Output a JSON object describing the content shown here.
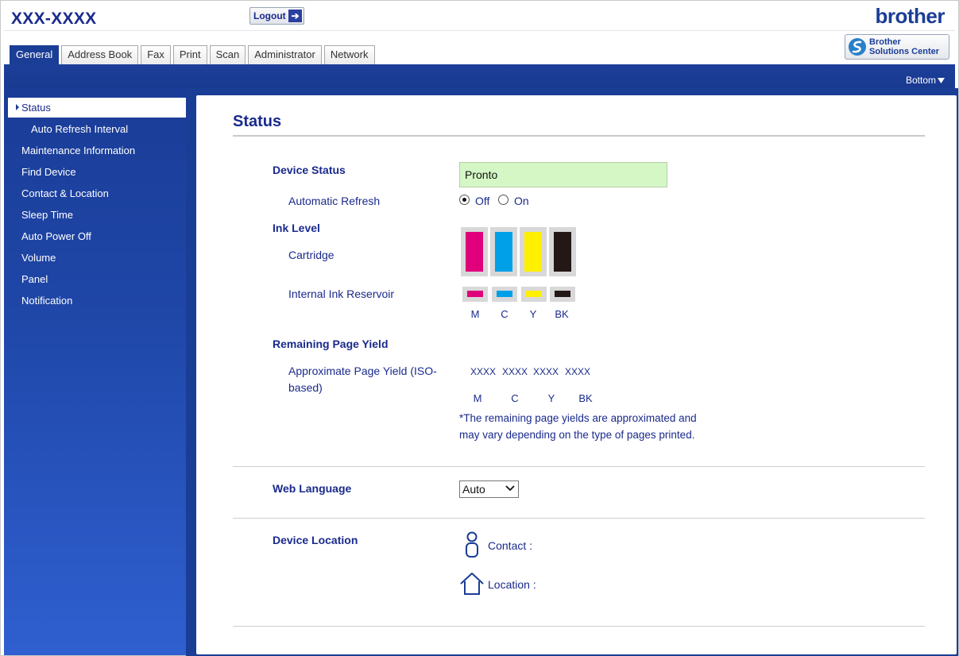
{
  "header": {
    "model": "XXX-XXXX",
    "logout_label": "Logout",
    "logo": "brother",
    "solutions_line1": "Brother",
    "solutions_line2": "Solutions Center"
  },
  "tabs": [
    {
      "label": "General",
      "active": true
    },
    {
      "label": "Address Book"
    },
    {
      "label": "Fax"
    },
    {
      "label": "Print"
    },
    {
      "label": "Scan"
    },
    {
      "label": "Administrator"
    },
    {
      "label": "Network"
    }
  ],
  "bottom_link": "Bottom",
  "sidebar": {
    "items": [
      {
        "label": "Status",
        "active": true
      },
      {
        "label": "Auto Refresh Interval",
        "sub": true
      },
      {
        "label": "Maintenance Information"
      },
      {
        "label": "Find Device"
      },
      {
        "label": "Contact & Location"
      },
      {
        "label": "Sleep Time"
      },
      {
        "label": "Auto Power Off"
      },
      {
        "label": "Volume"
      },
      {
        "label": "Panel"
      },
      {
        "label": "Notification"
      }
    ]
  },
  "main": {
    "title": "Status",
    "device_status_label": "Device Status",
    "device_status_value": "Pronto",
    "auto_refresh_label": "Automatic Refresh",
    "auto_refresh_off": "Off",
    "auto_refresh_on": "On",
    "auto_refresh_selected": "Off",
    "ink_level_label": "Ink Level",
    "cartridge_label": "Cartridge",
    "reservoir_label": "Internal Ink Reservoir",
    "ink_colors": [
      {
        "label": "M",
        "color": "#e0007b"
      },
      {
        "label": "C",
        "color": "#00a0e9"
      },
      {
        "label": "Y",
        "color": "#fff000"
      },
      {
        "label": "BK",
        "color": "#231815"
      }
    ],
    "remaining_yield_label": "Remaining Page Yield",
    "approx_yield_label": "Approximate Page Yield (ISO-based)",
    "approx_yield_line1": "Approximate Page Yield (ISO-",
    "approx_yield_line2": "based)",
    "yield_values": [
      "XXXX",
      "XXXX",
      "XXXX",
      "XXXX"
    ],
    "yield_labels": [
      "M",
      "C",
      "Y",
      "BK"
    ],
    "yield_note_line1": "*The remaining page yields are approximated and",
    "yield_note_line2": "may vary depending on the type of pages printed.",
    "web_language_label": "Web Language",
    "web_language_value": "Auto",
    "device_location_label": "Device Location",
    "contact_label": "Contact :",
    "location_label": "Location :"
  },
  "colors": {
    "brand_blue": "#1a3d96",
    "text_navy": "#1a2a8c",
    "status_green": "#d5f7c6"
  },
  "icons": [
    "logout-arrow-icon",
    "solutions-center-icon",
    "caret-right-icon",
    "triangle-down-icon",
    "person-icon",
    "house-icon",
    "chevron-down-icon"
  ]
}
